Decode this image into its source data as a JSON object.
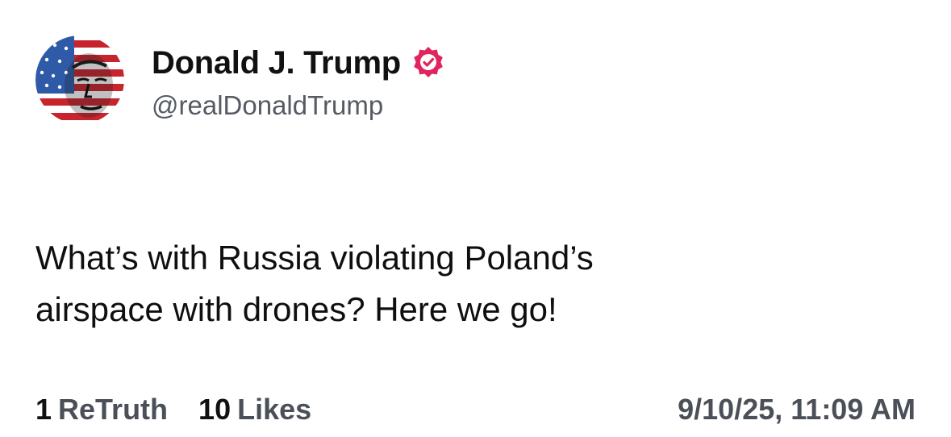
{
  "author": {
    "display_name": "Donald J. Trump",
    "handle": "@realDonaldTrump",
    "verified_icon": "verified-badge-icon",
    "verified_color": "#e0245e",
    "avatar": "profile-avatar"
  },
  "post": {
    "text_line_1": "What’s with Russia violating Poland’s",
    "text_line_2": "airspace with drones? Here we go!"
  },
  "stats": {
    "retruths_count": "1",
    "retruths_label": "ReTruth",
    "likes_count": "10",
    "likes_label": "Likes"
  },
  "timestamp": "9/10/25, 11:09 AM"
}
